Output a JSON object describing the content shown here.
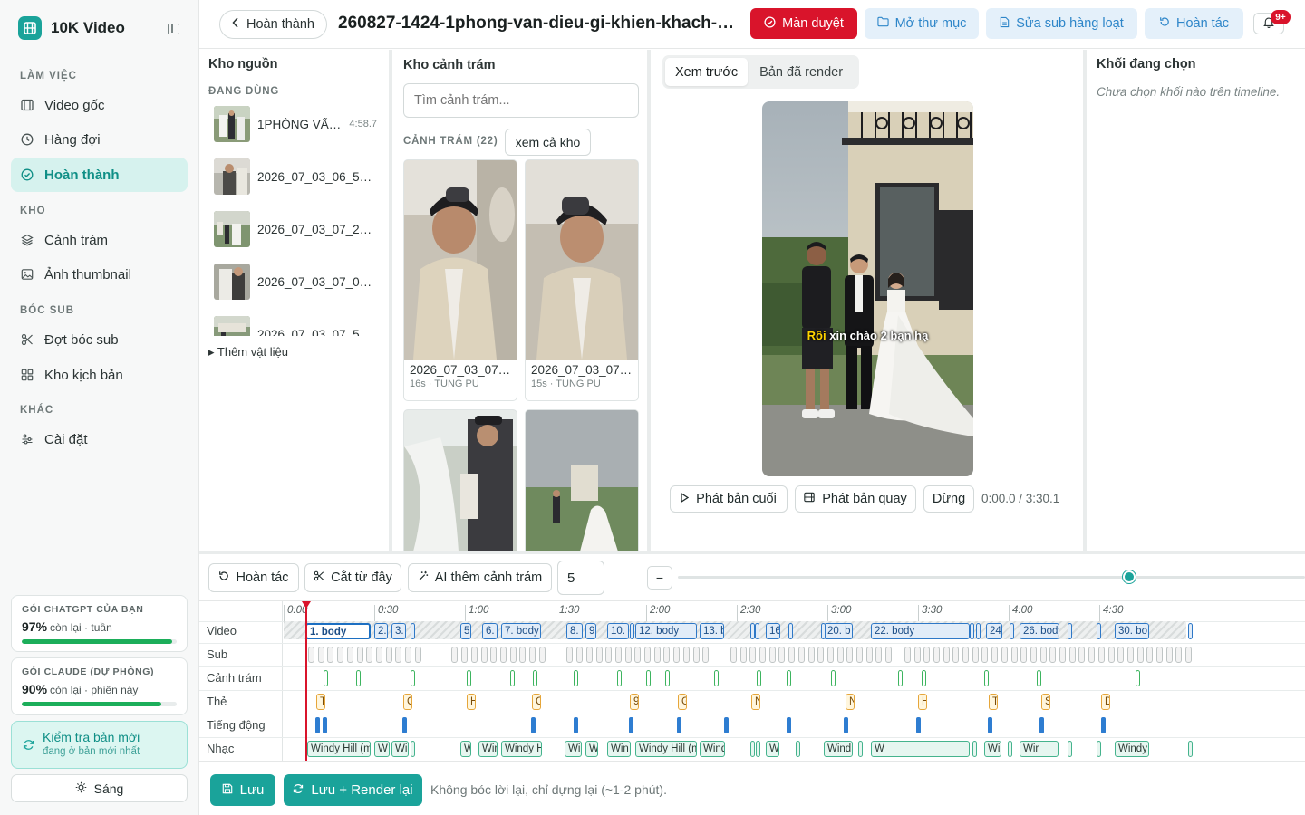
{
  "sidebar": {
    "brand": "10K Video",
    "sections": {
      "work": "LÀM VIỆC",
      "store": "KHO",
      "subs": "BÓC SUB",
      "other": "KHÁC"
    },
    "items": {
      "source_video": "Video gốc",
      "queue": "Hàng đợi",
      "done": "Hoàn thành",
      "broll": "Cảnh trám",
      "thumbnail": "Ảnh thumbnail",
      "sub_batch": "Đợt bóc sub",
      "scripts": "Kho kịch bản",
      "settings": "Cài đặt"
    },
    "quota_chatgpt": {
      "title": "GÓI CHATGPT CỦA BẠN",
      "percent": "97%",
      "note": "còn lại · tuần",
      "fraction": 0.97
    },
    "quota_claude": {
      "title": "GÓI CLAUDE (DỰ PHÒNG)",
      "percent": "90%",
      "note": "còn lại · phiên này",
      "fraction": 0.9
    },
    "update": {
      "title": "Kiểm tra bản mới",
      "sub": "đang ở bản mới nhất"
    },
    "theme": "Sáng"
  },
  "header": {
    "back": "Hoàn thành",
    "title": "260827-1424-1phong-van-dieu-gi-khien-khach-hang...",
    "review": "Màn duyệt",
    "open_folder": "Mở thư mục",
    "batch_sub": "Sửa sub hàng loạt",
    "undo": "Hoàn tác",
    "notif_badge": "9+"
  },
  "source": {
    "title": "Kho nguồn",
    "in_use": "ĐANG DÙNG",
    "items": [
      {
        "name": "1PHÒNG VẤN ĐIỀU GÌ",
        "dur": "4:58.7"
      },
      {
        "name": "2026_07_03_06_55_12",
        "dur": ""
      },
      {
        "name": "2026_07_03_07_22_40",
        "dur": ""
      },
      {
        "name": "2026_07_03_07_05_18",
        "dur": ""
      },
      {
        "name": "2026_07_03_07_51_09",
        "dur": ""
      }
    ],
    "more": "▸ Thêm vật liệu"
  },
  "broll": {
    "title": "Kho cảnh trám",
    "search_placeholder": "Tìm cảnh trám...",
    "count_label": "CẢNH TRÁM (22)",
    "see_all": "xem cả kho",
    "cards": [
      {
        "name": "2026_07_03_07_01",
        "meta": "16s · TUNG PU"
      },
      {
        "name": "2026_07_03_07_02",
        "meta": "15s · TUNG PU"
      }
    ]
  },
  "preview": {
    "tab_preview": "Xem trước",
    "tab_rendered": "Bản đã render",
    "caption_hl": "Rồi",
    "caption_rest": " xin chào 2 bạn hạ",
    "play_final": "Phát bản cuối",
    "play_raw": "Phát bản quay",
    "stop": "Dừng",
    "time": "0:00.0 / 3:30.1"
  },
  "selection": {
    "title": "Khối đang chọn",
    "empty": "Chưa chọn khối nào trên timeline."
  },
  "toolbar": {
    "undo": "Hoàn tác",
    "cut": "Cắt từ đây",
    "ai_broll": "AI thêm cảnh trám",
    "count": "5",
    "zoom_out": "−",
    "zoom_level": 0.72
  },
  "timeline": {
    "tracks": [
      "Video",
      "Sub",
      "Cảnh trám",
      "Thẻ",
      "Tiếng động",
      "Nhạc"
    ],
    "ruler": [
      "0:00",
      "0:30",
      "1:00",
      "1:30",
      "2:00",
      "2:30",
      "3:00",
      "3:30",
      "4:00",
      "4:30"
    ],
    "video_clips": [
      "1. body",
      "2.",
      "3. b",
      "5.",
      "6. b",
      "7. body",
      "8.",
      "9.",
      "10. b",
      "12. body",
      "13. b",
      "16",
      "20. b",
      "22. body",
      "24.",
      "26. body",
      "30. bo"
    ],
    "tag_clips": [
      "T",
      "C",
      "H",
      "C",
      "9",
      "G",
      "N",
      "N",
      "H",
      "T",
      "S",
      "D"
    ],
    "music_clips": [
      "Windy Hill (mp3",
      "W",
      "Wi",
      "W",
      "Win",
      "Windy H",
      "Wi",
      "W",
      "Win",
      "Windy Hill (m",
      "Wind",
      "W",
      "Wind",
      "W",
      "Windy Hill (mp3cut.n",
      "Wir",
      "Windy H",
      "Windy"
    ]
  },
  "footer": {
    "save": "Lưu",
    "save_render": "Lưu + Render lại",
    "note": "Không bóc lời lại, chỉ dựng lại (~1-2 phút)."
  }
}
